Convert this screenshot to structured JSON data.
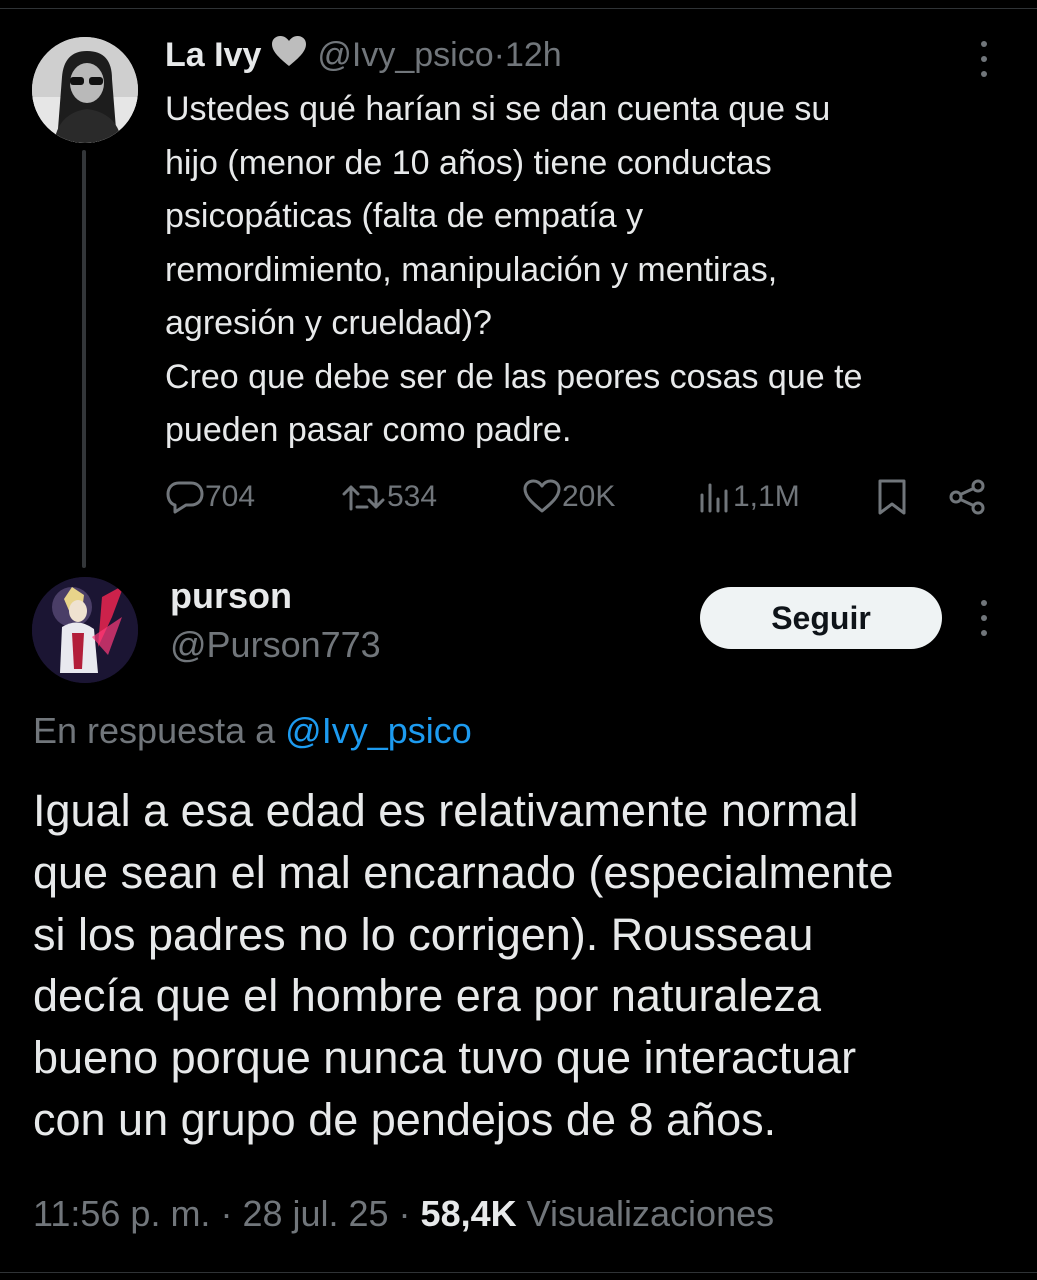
{
  "parent": {
    "name": "La Ivy",
    "handle": "@Ivy_psico",
    "separator": " · ",
    "time": "12h",
    "text_lines": [
      "Ustedes qué harían si se dan cuenta que su",
      "hijo (menor de 10 años) tiene conductas",
      "psicopáticas (falta de empatía y",
      "remordimiento, manipulación y mentiras,",
      "agresión y crueldad)?",
      "Creo que debe ser de las peores cosas que te",
      "pueden pasar como padre."
    ],
    "actions": {
      "replies": "704",
      "reposts": "534",
      "likes": "20K",
      "views": "1,1M"
    }
  },
  "reply": {
    "name": "purson",
    "handle": "@Purson773",
    "follow_label": "Seguir",
    "in_reply_prefix": "En respuesta a ",
    "in_reply_mention": "@Ivy_psico",
    "text_lines": [
      "Igual a esa edad es relativamente normal",
      "que sean el mal encarnado (especialmente",
      "si los padres no lo corrigen). Rousseau",
      "decía que el hombre era por naturaleza",
      "bueno porque nunca tuvo que interactuar",
      "con un grupo de pendejos de 8 años."
    ],
    "time": "11:56 p. m.",
    "sep1": " · ",
    "date": "28 jul. 25",
    "sep2": " · ",
    "views_count": "58,4K",
    "views_label": " Visualizaciones"
  },
  "colors": {
    "background": "#000000",
    "text": "#e7e9ea",
    "muted": "#71767b",
    "link": "#1d9bf0",
    "button_bg": "#eff3f4"
  },
  "icons": [
    "heart-icon",
    "more-icon",
    "reply-icon",
    "repost-icon",
    "like-icon",
    "views-icon",
    "bookmark-icon",
    "share-icon"
  ]
}
